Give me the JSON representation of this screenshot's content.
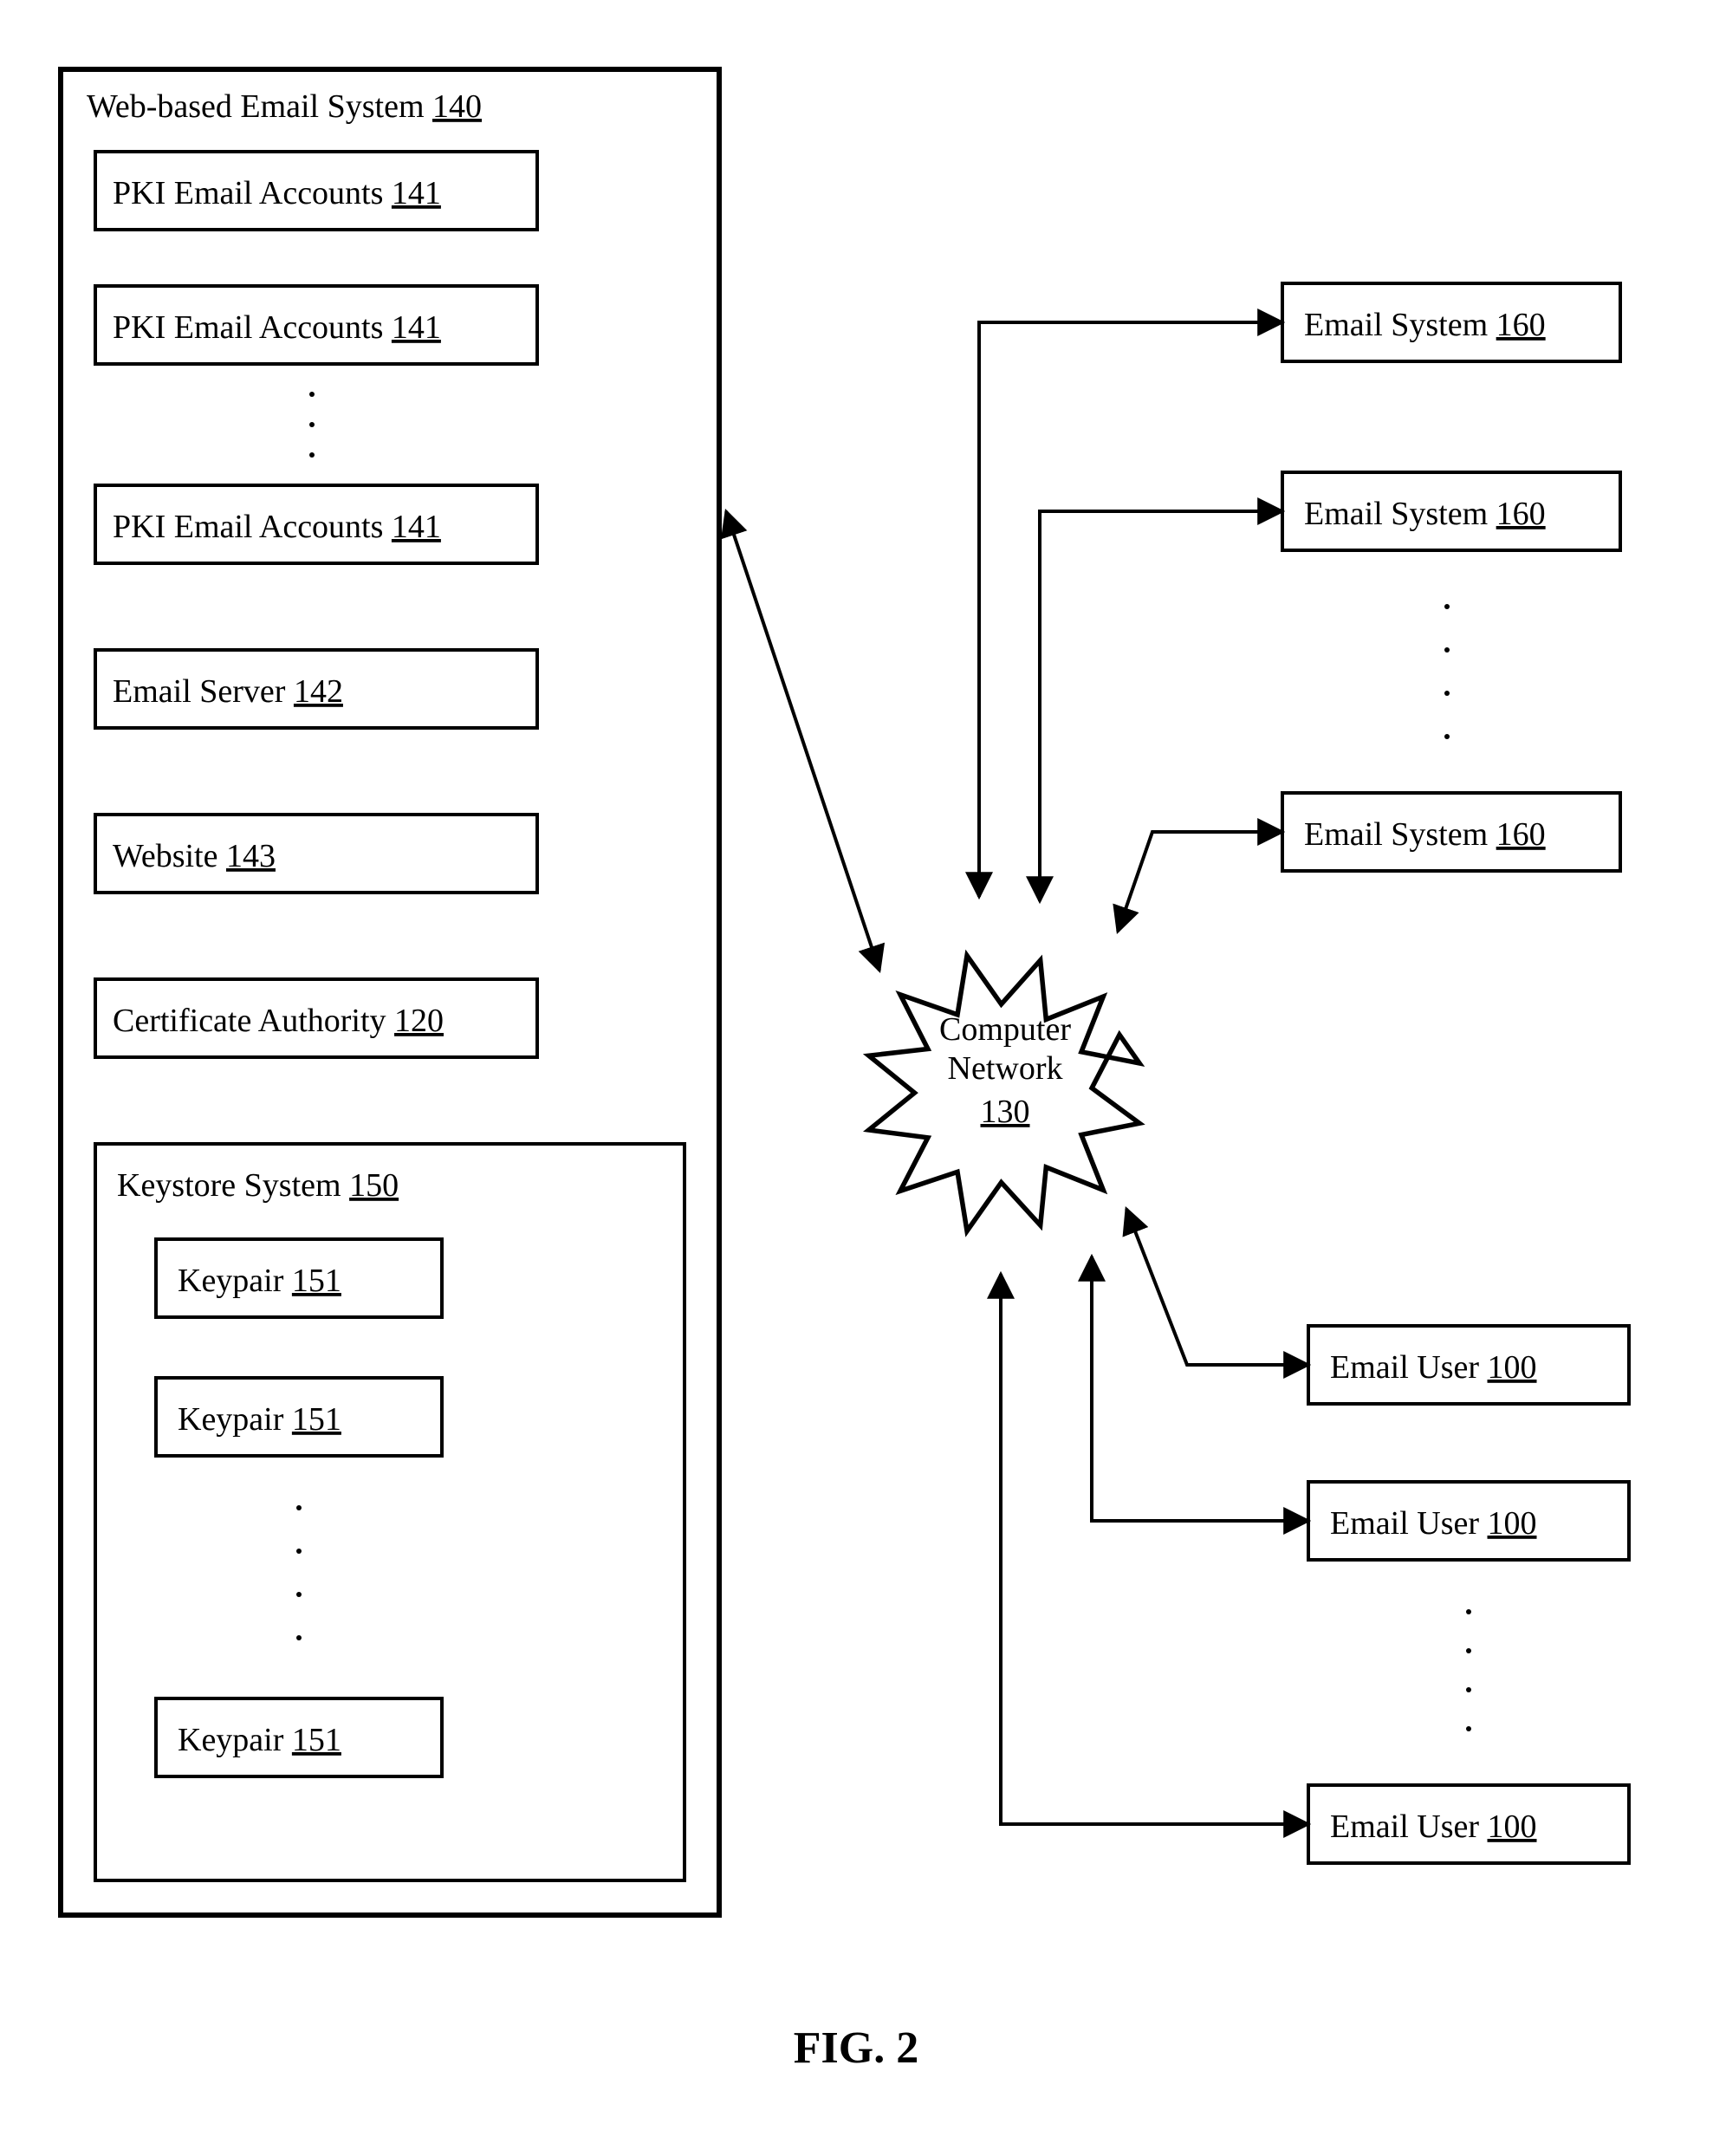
{
  "figure_label": "FIG. 2",
  "network": {
    "line1": "Computer",
    "line2": "Network",
    "ref": "130"
  },
  "webSystem": {
    "label": "Web-based Email System",
    "ref": "140"
  },
  "pkiAccounts": [
    {
      "label": "PKI Email Accounts",
      "ref": "141"
    },
    {
      "label": "PKI Email Accounts",
      "ref": "141"
    },
    {
      "label": "PKI Email Accounts",
      "ref": "141"
    }
  ],
  "emailServer": {
    "label": "Email Server",
    "ref": "142"
  },
  "website": {
    "label": "Website",
    "ref": "143"
  },
  "certAuth": {
    "label": "Certificate Authority",
    "ref": "120"
  },
  "keystore": {
    "label": "Keystore System",
    "ref": "150"
  },
  "keypairs": [
    {
      "label": "Keypair",
      "ref": "151"
    },
    {
      "label": "Keypair",
      "ref": "151"
    },
    {
      "label": "Keypair",
      "ref": "151"
    }
  ],
  "emailSystems": [
    {
      "label": "Email System",
      "ref": "160"
    },
    {
      "label": "Email System",
      "ref": "160"
    },
    {
      "label": "Email System",
      "ref": "160"
    }
  ],
  "emailUsers": [
    {
      "label": "Email User",
      "ref": "100"
    },
    {
      "label": "Email User",
      "ref": "100"
    },
    {
      "label": "Email User",
      "ref": "100"
    }
  ]
}
